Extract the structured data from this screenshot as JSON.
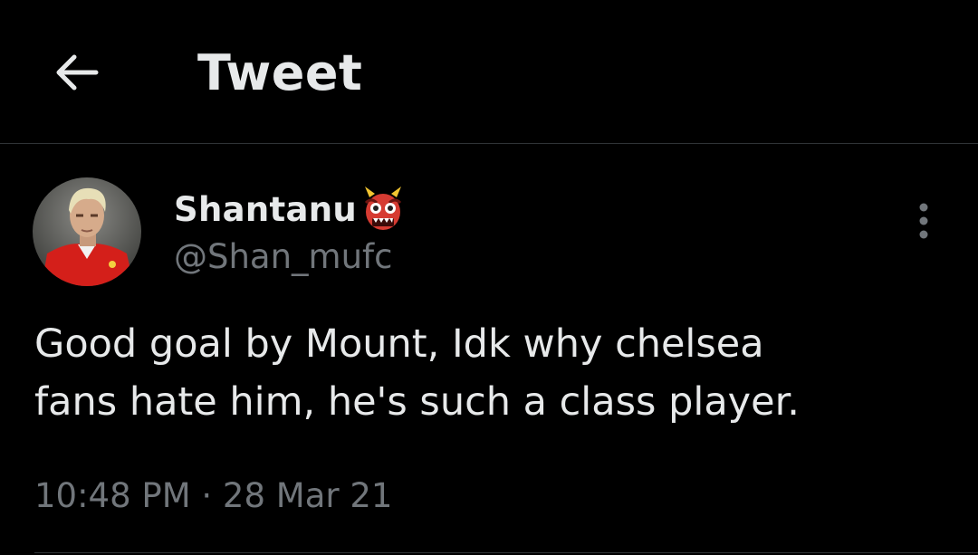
{
  "header": {
    "back_icon": "arrow-left-icon",
    "title": "Tweet"
  },
  "tweet": {
    "author": {
      "display_name": "Shantanu",
      "name_emoji": "ogre-emoji-icon",
      "handle": "@Shan_mufc",
      "avatar_icon": "profile-photo"
    },
    "more_icon": "more-vertical-icon",
    "text": "Good goal by Mount, Idk why chelsea\nfans hate him, he's such a class player.",
    "time": "10:48 PM",
    "separator": "·",
    "date": "28 Mar 21"
  },
  "colors": {
    "background": "#000000",
    "primary_text": "#e7e9ea",
    "secondary_text": "#71767b",
    "divider": "#2f3336"
  }
}
